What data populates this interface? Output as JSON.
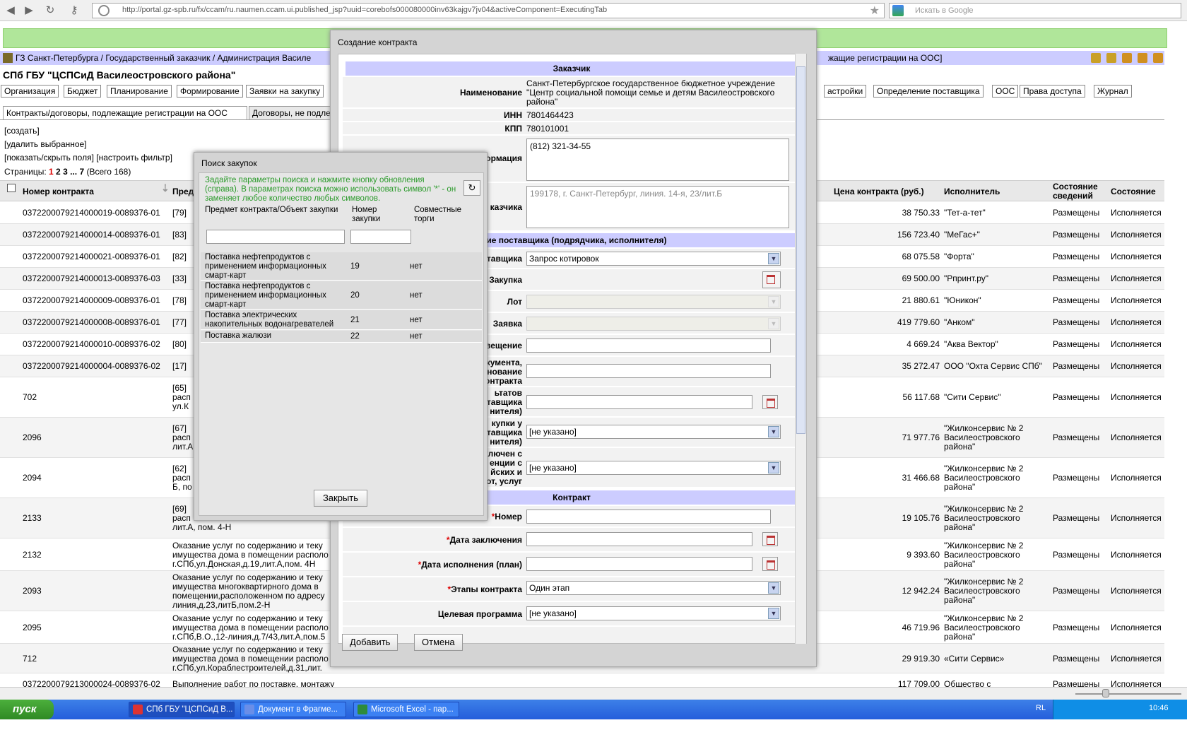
{
  "browser": {
    "url": "http://portal.gz-spb.ru/fx/ccam/ru.naumen.ccam.ui.published_jsp?uuid=corebofs000080000inv63kajgv7jv04&activeComponent=ExecutingTab",
    "search_placeholder": "Искать в Google"
  },
  "breadcrumb": "ГЗ Санкт-Петербурга / Государственный заказчик / Администрация Василе",
  "breadcrumb_right": "жащие регистрации на ООС]",
  "org_title": "СПб ГБУ \"ЦСПСиД Василеостровского района\"",
  "menu": [
    "Организация",
    "Бюджет",
    "Планирование",
    "Формирование",
    "Заявки на закупку"
  ],
  "menu_right": [
    "астройки",
    "Определение поставщика",
    "ООС",
    "Права доступа",
    "Журнал"
  ],
  "tabs": [
    "Контракты/договоры, подлежащие регистрации на ООС",
    "Договоры, не подле"
  ],
  "commands": [
    "[создать]",
    "[удалить выбранное]",
    "[показать/скрыть поля] [настроить фильтр]"
  ],
  "pages": {
    "label": "Страницы:",
    "current": "1",
    "p2": "2",
    "p3": "3",
    "dots": "...",
    "last": "7",
    "total": "(Всего 168)"
  },
  "table": {
    "headers": {
      "number": "Номер контракта",
      "subject": "Пред",
      "price": "Цена контракта (руб.)",
      "executor": "Исполнитель",
      "info_state": "Состояние сведений",
      "state": "Состояние"
    },
    "rows": [
      {
        "number": "0372200079214000019-0089376-01",
        "subject": "[79]",
        "price": "38 750.33",
        "executor": "\"Тет-а-тет\"",
        "info": "Размещены",
        "state": "Исполняется"
      },
      {
        "number": "0372200079214000014-0089376-01",
        "subject": "[83]",
        "price": "156 723.40",
        "executor": "\"МеГас+\"",
        "info": "Размещены",
        "state": "Исполняется"
      },
      {
        "number": "0372200079214000021-0089376-01",
        "subject": "[82]",
        "price": "68 075.58",
        "executor": "\"Форта\"",
        "info": "Размещены",
        "state": "Исполняется"
      },
      {
        "number": "0372200079214000013-0089376-03",
        "subject": "[33]",
        "price": "69 500.00",
        "executor": "\"Рпринт.ру\"",
        "info": "Размещены",
        "state": "Исполняется"
      },
      {
        "number": "0372200079214000009-0089376-01",
        "subject": "[78]",
        "price": "21 880.61",
        "executor": "\"Юникон\"",
        "info": "Размещены",
        "state": "Исполняется"
      },
      {
        "number": "0372200079214000008-0089376-01",
        "subject": "[77]",
        "price": "419 779.60",
        "executor": "\"Анком\"",
        "info": "Размещены",
        "state": "Исполняется"
      },
      {
        "number": "0372200079214000010-0089376-02",
        "subject": "[80]",
        "price": "4 669.24",
        "executor": "\"Аква Вектор\"",
        "info": "Размещены",
        "state": "Исполняется"
      },
      {
        "number": "0372200079214000004-0089376-02",
        "subject": "[17]",
        "price": "35 272.47",
        "executor": "ООО \"Охта Сервис СПб\"",
        "info": "Размещены",
        "state": "Исполняется"
      },
      {
        "number": "702",
        "subject": "[65]\nрасп\nул.К",
        "price": "56 117.68",
        "executor": "\"Сити Сервис\"",
        "info": "Размещены",
        "state": "Исполняется"
      },
      {
        "number": "2096",
        "subject": "[67]\nрасп\nлит.А",
        "price": "71 977.76",
        "executor": "\"Жилконсервис № 2\nВасилеостровского\nрайона\"",
        "info": "Размещены",
        "state": "Исполняется"
      },
      {
        "number": "2094",
        "subject": "[62]\nрасп\nБ, по",
        "price": "31 466.68",
        "executor": "\"Жилконсервис № 2\nВасилеостровского\nрайона\"",
        "info": "Размещены",
        "state": "Исполняется"
      },
      {
        "number": "2133",
        "subject": "[69]\nрасп\nлит.А, пом. 4-Н",
        "price": "19 105.76",
        "executor": "\"Жилконсервис № 2\nВасилеостровского\nрайона\"",
        "info": "Размещены",
        "state": "Исполняется"
      },
      {
        "number": "2132",
        "subject": "Оказание услуг по содержанию и теку\nимущества дома в помещении располо\nг.СПб,ул.Донская,д.19,лит.А,пом. 4Н",
        "price": "9 393.60",
        "executor": "\"Жилконсервис № 2\nВасилеостровского\nрайона\"",
        "info": "Размещены",
        "state": "Исполняется"
      },
      {
        "number": "2093",
        "subject": "Оказание услуг по содержанию и теку\nимущества многоквартирного дома в\nпомещении,расположенном по адресу\nлиния,д.23,литБ,пом.2-Н",
        "price": "12 942.24",
        "executor": "\"Жилконсервис № 2\nВасилеостровского\nрайона\"",
        "info": "Размещены",
        "state": "Исполняется"
      },
      {
        "number": "2095",
        "subject": "Оказание услуг по содержанию и теку\nимущества дома в помещении располо\nг.СПб,В.О.,12-линия,д.7/43,лит.А,пом.5",
        "price": "46 719.96",
        "executor": "\"Жилконсервис № 2\nВасилеостровского\nрайона\"",
        "info": "Размещены",
        "state": "Исполняется"
      },
      {
        "number": "712",
        "subject": "Оказание услуг по содержанию и теку\nимущества дома в помещении располо\nг.СПб,ул.Кораблестроителей,д.31,лит.",
        "price": "29 919.30",
        "executor": "«Сити Сервис»",
        "info": "Размещены",
        "state": "Исполняется"
      },
      {
        "number": "0372200079213000024-0089376-02",
        "subject": "Выполнение работ по поставке, монтажу канализационного",
        "price": "117 709.00",
        "executor": "Общество с",
        "info": "Размещены",
        "state": "Исполняется"
      }
    ]
  },
  "dialog": {
    "title": "Создание контракта",
    "sec_customer": "Заказчик",
    "lbl_name": "Наименование",
    "val_name": "Санкт-Петербургское государственное бюджетное учреждение \"Центр социальной помощи семье и детям Василеостровского района\"",
    "lbl_inn": "ИНН",
    "val_inn": "7801464423",
    "lbl_kpp": "КПП",
    "val_kpp": "780101001",
    "lbl_contact": "ормация",
    "val_contact": "(812) 321-34-55",
    "lbl_address": "казчика",
    "val_address": "199178, г. Санкт-Петербург, линия. 14-я, 23/лит.Б",
    "sec_supplier": "ение поставщика (подрядчика, исполнителя)",
    "lbl_method": "тавщика",
    "val_method": "Запрос котировок",
    "lbl_purchase": "Закупка",
    "lbl_lot": "Лот",
    "lbl_bid": "Заявка",
    "lbl_notice": "вещение",
    "lbl_doc": "кумента,\nнование\nонтракта",
    "lbl_results": "ьтатов\nтавщика\nнителя)",
    "lbl_from": "купки у\nтавщика\nнителя)",
    "val_from": "[не указано]",
    "lbl_concluded": "ключен с\nенции с\nйских и\nот, услуг",
    "val_concluded": "[не указано]",
    "sec_contract": "Контракт",
    "lbl_number": "Номер",
    "lbl_date": "Дата заключения",
    "lbl_exec_date": "Дата исполнения (план)",
    "lbl_stages": "Этапы контракта",
    "val_stages": "Один этап",
    "lbl_program": "Целевая программа",
    "val_program": "[не указано]",
    "btn_add": "Добавить",
    "btn_cancel": "Отмена"
  },
  "search": {
    "title": "Поиск закупок",
    "hint": "Задайте параметры поиска и нажмите кнопку обновления (справа). В параметрах поиска можно использовать символ '*' - он заменяет любое количество любых символов.",
    "col_subject": "Предмет контракта/Объект закупки",
    "col_number": "Номер закупки",
    "col_joint": "Совместные торги",
    "rows": [
      {
        "subject": "Поставка нефтепродуктов с применением информационных смарт-карт",
        "number": "19",
        "joint": "нет"
      },
      {
        "subject": "Поставка нефтепродуктов с применением информационных смарт-карт",
        "number": "20",
        "joint": "нет"
      },
      {
        "subject": "Поставка электрических накопительных водонагревателей",
        "number": "21",
        "joint": "нет"
      },
      {
        "subject": "Поставка жалюзи",
        "number": "22",
        "joint": "нет"
      }
    ],
    "btn_close": "Закрыть"
  },
  "taskbar": {
    "start": "пуск",
    "tasks": [
      "СПб ГБУ \"ЦСПСиД В...",
      "Документ в Фрагме...",
      "Microsoft Excel - пар..."
    ],
    "lang": "RL",
    "clock": "10:46"
  }
}
